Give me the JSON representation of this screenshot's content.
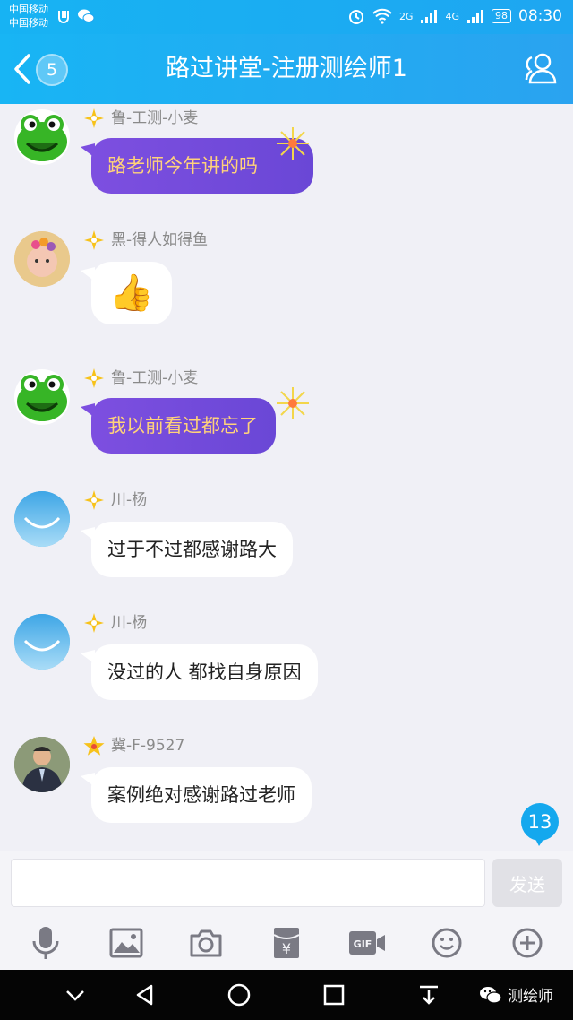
{
  "status_bar": {
    "carrier1": "中国移动",
    "carrier2": "中国移动",
    "sim1_type": "2G",
    "sim2_type": "4G",
    "battery": "98",
    "time": "08:30"
  },
  "header": {
    "unread": "5",
    "title": "路过讲堂-注册测绘师1"
  },
  "messages": [
    {
      "sender": "鲁-工测-小麦",
      "text": "路老师今年讲的吗",
      "style": "purple"
    },
    {
      "sender": "黑-得人如得鱼",
      "text": "👍",
      "style": "white"
    },
    {
      "sender": "鲁-工测-小麦",
      "text": "我以前看过都忘了",
      "style": "purple"
    },
    {
      "sender": "川-杨",
      "text": "过于不过都感谢路大",
      "style": "white"
    },
    {
      "sender": "川-杨",
      "text": "没过的人 都找自身原因",
      "style": "white"
    },
    {
      "sender": "冀-F-9527",
      "text": "案例绝对感谢路过老师",
      "style": "white"
    }
  ],
  "new_messages_count": "13",
  "composer": {
    "value": "",
    "send_label": "发送"
  },
  "toolbar": {
    "gif_label": "GIF"
  },
  "watermark": "测绘师",
  "colors": {
    "header": "#1ea6f1",
    "purple_bubble": "#7d4fe0",
    "purple_text": "#ffd27a",
    "badge_blue": "#14a8ee"
  }
}
